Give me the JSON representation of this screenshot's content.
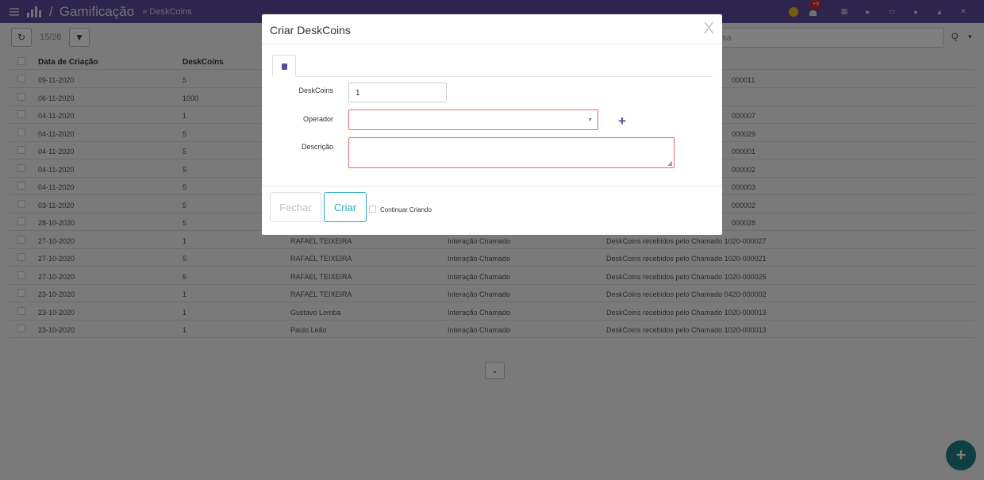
{
  "topbar": {
    "title": "Gamificação",
    "breadcrumb": "» DeskCoins",
    "notifications_badge": "+9",
    "icons": [
      "coin-icon",
      "bell-icon",
      "grid-icon",
      "play-icon",
      "monitor-icon",
      "help-icon",
      "user-icon",
      "settings-icon"
    ]
  },
  "toolbar": {
    "counter": "15/26",
    "search_placeholder": "sa"
  },
  "table": {
    "headers": [
      "Data de Criação",
      "DeskCoins"
    ],
    "rows": [
      [
        "09-11-2020",
        "5",
        "",
        "",
        "000011"
      ],
      [
        "06-11-2020",
        "1000",
        "",
        "",
        ""
      ],
      [
        "04-11-2020",
        "1",
        "",
        "",
        "000007"
      ],
      [
        "04-11-2020",
        "5",
        "",
        "",
        "000029"
      ],
      [
        "04-11-2020",
        "5",
        "",
        "",
        "000001"
      ],
      [
        "04-11-2020",
        "5",
        "",
        "",
        "000002"
      ],
      [
        "04-11-2020",
        "5",
        "",
        "",
        "000003"
      ],
      [
        "03-11-2020",
        "5",
        "",
        "",
        "000002"
      ],
      [
        "28-10-2020",
        "5",
        "",
        "",
        "000028"
      ],
      [
        "27-10-2020",
        "1",
        "RAFAEL TEIXEIRA",
        "Interação Chamado",
        "DeskCoins recebidos pelo Chamado 1020-000027"
      ],
      [
        "27-10-2020",
        "5",
        "RAFAEL TEIXEIRA",
        "Interação Chamado",
        "DeskCoins recebidos pelo Chamado 1020-000021"
      ],
      [
        "27-10-2020",
        "5",
        "RAFAEL TEIXEIRA",
        "Interação Chamado",
        "DeskCoins recebidos pelo Chamado 1020-000025"
      ],
      [
        "23-10-2020",
        "1",
        "RAFAEL TEIXEIRA",
        "Interação Chamado",
        "DeskCoins recebidos pelo Chamado 0420-000002"
      ],
      [
        "23-10-2020",
        "1",
        "Gustavo Lomba",
        "Interação Chamado",
        "DeskCoins recebidos pelo Chamado 1020-000013"
      ],
      [
        "23-10-2020",
        "1",
        "Paulo Leão",
        "Interação Chamado",
        "DeskCoins recebidos pelo Chamado 1020-000013"
      ]
    ]
  },
  "modal": {
    "title": "Criar DeskCoins",
    "close": "X",
    "fields": {
      "deskcoins_label": "DeskCoins",
      "deskcoins_value": "1",
      "operador_label": "Operador",
      "operador_value": "",
      "descricao_label": "Descrição",
      "descricao_value": ""
    },
    "buttons": {
      "fechar": "Fechar",
      "criar": "Criar",
      "continuar": "Continuar Criando"
    }
  },
  "colors": {
    "topbar": "#5b4a9b",
    "accent": "#5b4a9b",
    "criar_button": "#2aa9c2",
    "error_border": "#e56b6b",
    "fab": "#1d7f86"
  }
}
